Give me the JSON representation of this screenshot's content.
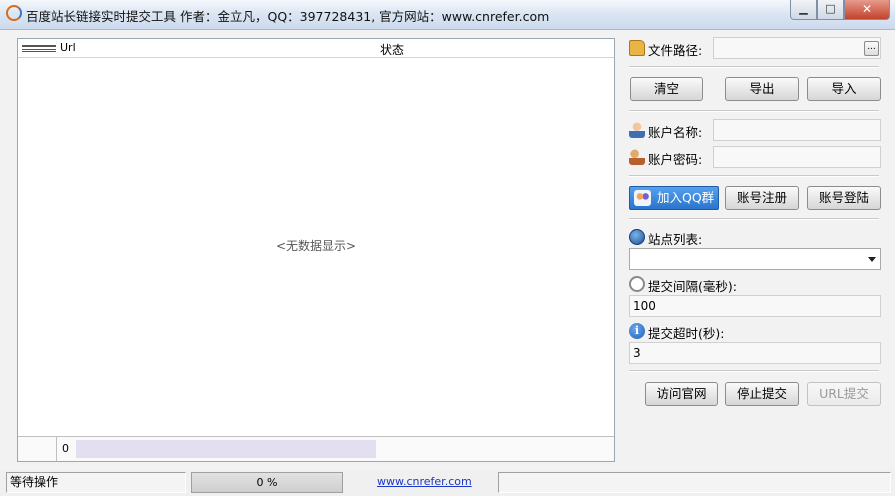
{
  "window": {
    "title": "百度站长链接实时提交工具 作者：金立凡，QQ：397728431, 官方网站：www.cnrefer.com",
    "buttons": {
      "minimize": "▁",
      "maximize": "□",
      "close": "✕"
    }
  },
  "list": {
    "columns": [
      "Url",
      "状态"
    ],
    "empty_text": "<无数据显示>",
    "footer_count": "0"
  },
  "panel": {
    "file_path_label": "文件路径:",
    "file_path_value": "",
    "browse_label": "...",
    "clear_button": "清空",
    "export_button": "导出",
    "import_button": "导入",
    "account_name_label": "账户名称:",
    "account_name_value": "",
    "account_password_label": "账户密码:",
    "account_password_value": "",
    "join_qq_button": "加入QQ群",
    "register_button": "账号注册",
    "login_button": "账号登陆",
    "site_list_label": "站点列表:",
    "site_list_value": "",
    "interval_label": "提交间隔(毫秒):",
    "interval_value": "100",
    "timeout_label": "提交超时(秒):",
    "timeout_value": "3",
    "visit_site_button": "访问官网",
    "stop_submit_button": "停止提交",
    "url_submit_button": "URL提交"
  },
  "statusbar": {
    "status_text": "等待操作",
    "progress_text": "0 %",
    "progress_value": 0,
    "link_text": "www.cnrefer.com"
  },
  "icons": [
    "app-icon",
    "folder-icon",
    "user-icon",
    "users-icon",
    "qq-icon",
    "globe-icon",
    "clock-icon",
    "info-icon"
  ],
  "colors": {
    "qq_button": "#2b74cc",
    "link": "#1a37c8",
    "close_button": "#c2432c"
  }
}
